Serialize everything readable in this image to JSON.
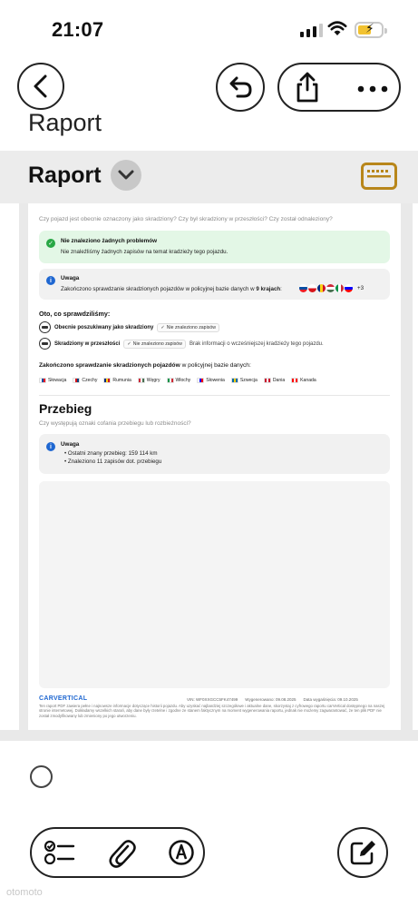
{
  "status_bar": {
    "time": "21:07"
  },
  "nav": {
    "title": "Raport"
  },
  "report_header": {
    "title": "Raport"
  },
  "theft": {
    "question": "Czy pojazd jest obecnie oznaczony jako skradziony? Czy był skradziony w przeszłości? Czy został odnaleziony?",
    "ok_title": "Nie znaleziono żadnych problemów",
    "ok_desc": "Nie znaleźliśmy żadnych zapisów na temat kradzieży tego pojazdu.",
    "note_title": "Uwaga",
    "note_text": "Zakończono sprawdzanie skradzionych pojazdów w policyjnej bazie danych w",
    "note_bold": "9 krajach",
    "note_more": "+3",
    "checked_heading": "Oto, co sprawdziliśmy:",
    "rows": [
      {
        "label": "Obecnie poszukiwany jako skradziony",
        "tag": "Nie znaleziono zapisów",
        "info": ""
      },
      {
        "label": "Skradziony w przeszłości",
        "tag": "Nie znaleziono zapisów",
        "info": "Brak informacji o wcześniejszej kradzieży tego pojazdu."
      }
    ],
    "db_heading_bold": "Zakończono sprawdzanie skradzionych pojazdów",
    "db_heading_rest": "w policyjnej bazie danych:",
    "countries": [
      {
        "name": "Słowacja",
        "colors": [
          "#ffffff",
          "#0b4ea2",
          "#ee1c25"
        ]
      },
      {
        "name": "Czechy",
        "colors": [
          "#ffffff",
          "#d7141a",
          "#11457e"
        ]
      },
      {
        "name": "Rumunia",
        "colors": [
          "#002b7f",
          "#fcd116",
          "#ce1126"
        ]
      },
      {
        "name": "Węgry",
        "colors": [
          "#ce2939",
          "#ffffff",
          "#477050"
        ]
      },
      {
        "name": "Włochy",
        "colors": [
          "#009246",
          "#ffffff",
          "#ce2b37"
        ]
      },
      {
        "name": "Słowenia",
        "colors": [
          "#ffffff",
          "#0000ff",
          "#ff0000"
        ]
      },
      {
        "name": "Szwecja",
        "colors": [
          "#006aa7",
          "#fecc00",
          "#006aa7"
        ]
      },
      {
        "name": "Dania",
        "colors": [
          "#c8102e",
          "#ffffff",
          "#c8102e"
        ]
      },
      {
        "name": "Kanada",
        "colors": [
          "#ff0000",
          "#ffffff",
          "#ff0000"
        ]
      }
    ]
  },
  "mileage": {
    "title": "Przebieg",
    "question": "Czy występują oznaki cofania przebiegu lub rozbieżności?",
    "note_title": "Uwaga",
    "bullets": [
      "Ostatni znany przebieg: 159 114 km",
      "Znaleziono 11 zapisów dot. przebiegu"
    ]
  },
  "footer": {
    "logo": "CARVERTICAL",
    "vin": "VIN: WF0XXGCC5FK47499",
    "generated": "Wygenerowano: 09.08.2025",
    "expires": "Data wygaśnięcia: 09.10.2025",
    "disclaimer": "Ten raport PDF zawiera pełne i najnowsze informacje dotyczące historii pojazdu. Aby uzyskać najbardziej szczegółowe i aktualne dane, skorzystaj z cyfrowego raportu carVertical dostępnego na naszej stronie internetowej. Dokładamy wszelkich starań, aby dane były rzetelne i zgodne ze stanem faktycznym na moment wygenerowania raportu, jednak nie możemy zagwarantować, że ten plik PDF nie został zmodyfikowany lub zmieniony po jego utworzeniu."
  },
  "watermark": "otomoto",
  "colors": {
    "accent": "#1f67d1",
    "keyboard_icon": "#b8861a",
    "success": "#28a745",
    "info": "#1f67d1"
  }
}
